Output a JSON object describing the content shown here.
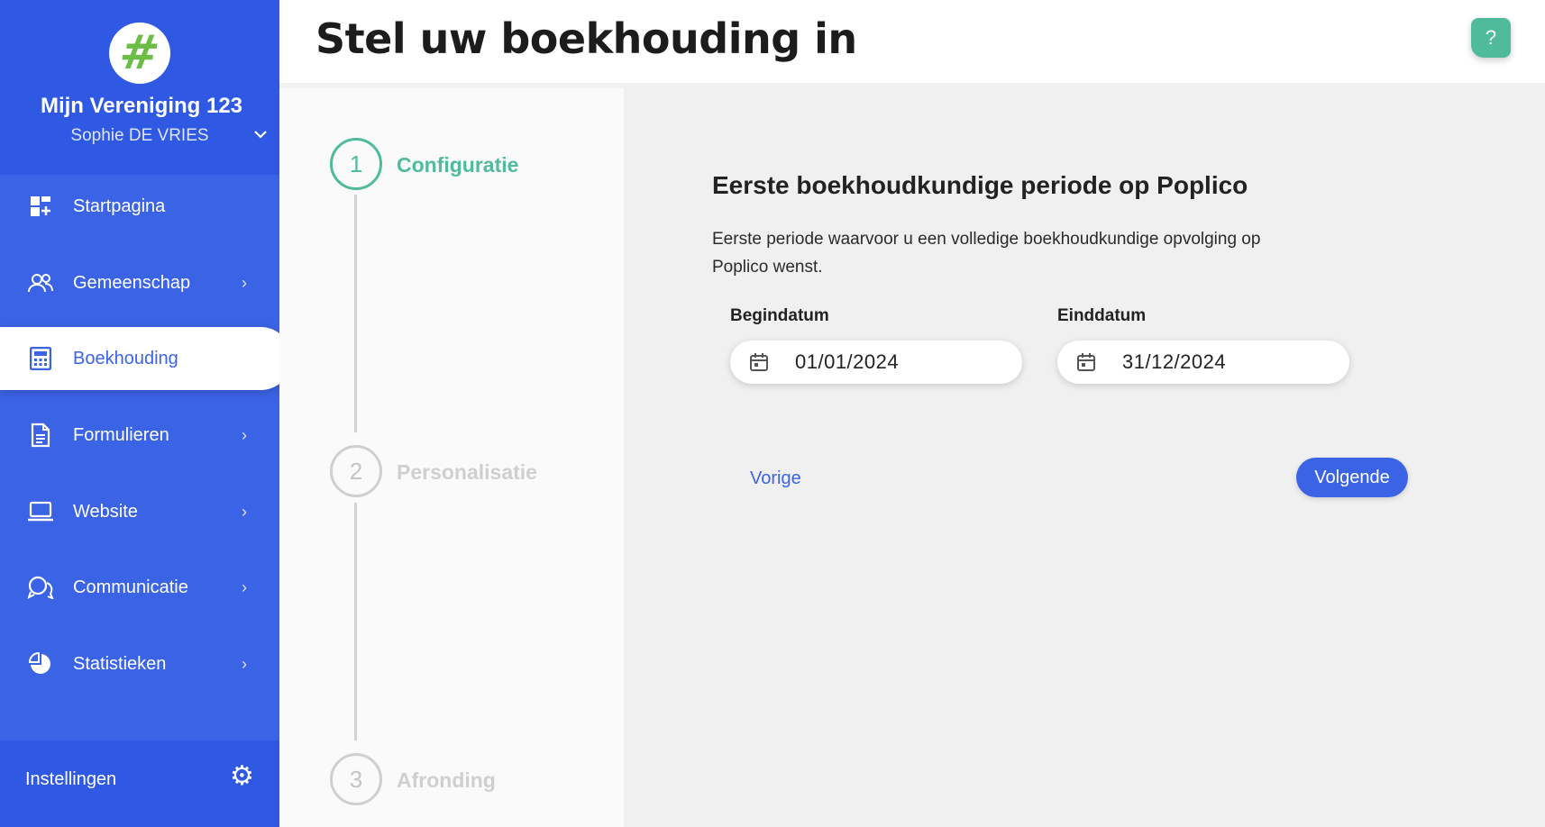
{
  "sidebar": {
    "org_name": "Mijn Vereniging 123",
    "user_name": "Sophie DE VRIES",
    "items": [
      {
        "label": "Startpagina",
        "icon": "dashboard-icon",
        "chevron": false,
        "active": false
      },
      {
        "label": "Gemeenschap",
        "icon": "community-icon",
        "chevron": true,
        "active": false
      },
      {
        "label": "Boekhouding",
        "icon": "calculator-icon",
        "chevron": false,
        "active": true
      },
      {
        "label": "Formulieren",
        "icon": "document-icon",
        "chevron": true,
        "active": false
      },
      {
        "label": "Website",
        "icon": "laptop-icon",
        "chevron": true,
        "active": false
      },
      {
        "label": "Communicatie",
        "icon": "chat-icon",
        "chevron": true,
        "active": false
      },
      {
        "label": "Statistieken",
        "icon": "pie-chart-icon",
        "chevron": true,
        "active": false
      }
    ],
    "settings_label": "Instellingen"
  },
  "header": {
    "title": "Stel uw boekhouding in",
    "help_label": "?"
  },
  "stepper": {
    "steps": [
      {
        "number": "1",
        "label": "Configuratie",
        "active": true
      },
      {
        "number": "2",
        "label": "Personalisatie",
        "active": false
      },
      {
        "number": "3",
        "label": "Afronding",
        "active": false
      }
    ]
  },
  "form": {
    "title": "Eerste boekhoudkundige periode op Poplico",
    "description": "Eerste periode waarvoor u een volledige boekhoudkundige opvolging op Poplico wenst.",
    "start_label": "Begindatum",
    "start_value": "01/01/2024",
    "end_label": "Einddatum",
    "end_value": "31/12/2024",
    "prev_label": "Vorige",
    "next_label": "Volgende"
  },
  "colors": {
    "primary": "#3b63e6",
    "accent_green": "#4fbb9b",
    "logo_green": "#6bbd46"
  }
}
